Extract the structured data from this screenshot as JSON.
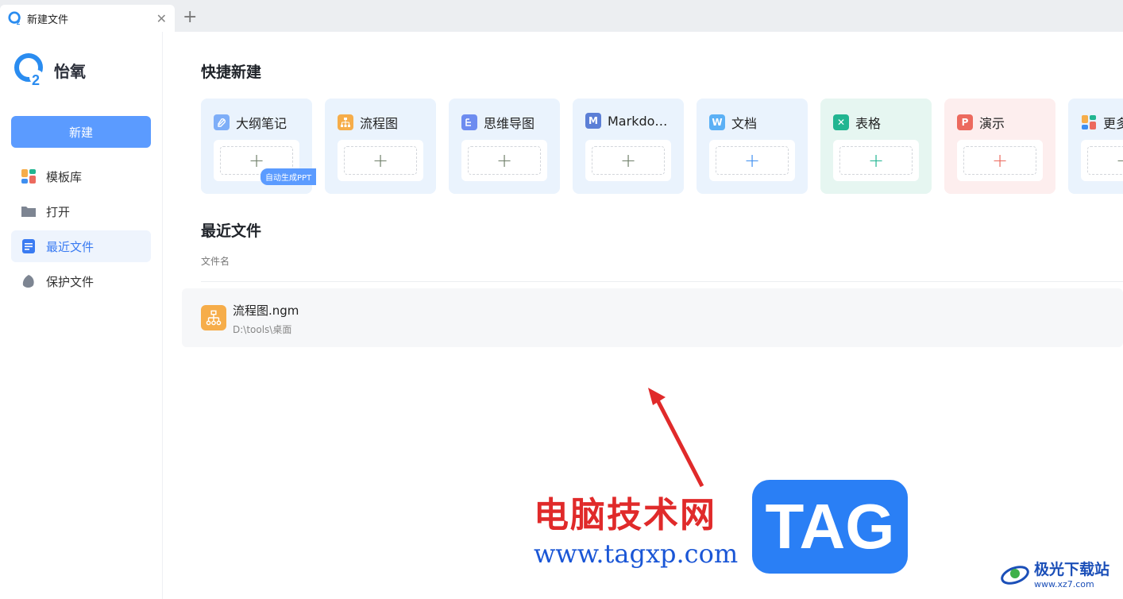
{
  "tab": {
    "title": "新建文件",
    "close": "✕",
    "new_tab": "+"
  },
  "sidebar": {
    "brand": "怡氧",
    "new_button": "新建",
    "items": [
      {
        "label": "模板库",
        "icon": "template-icon"
      },
      {
        "label": "打开",
        "icon": "folder-icon"
      },
      {
        "label": "最近文件",
        "icon": "recent-file-icon",
        "active": true
      },
      {
        "label": "保护文件",
        "icon": "shield-icon"
      }
    ]
  },
  "quick": {
    "title": "快捷新建",
    "badge": "自动生成PPT",
    "cards": [
      {
        "label": "大纲笔记",
        "icon": "outline-note-icon",
        "bg": "#eaf3fd",
        "plus_color": "#6f7f6a"
      },
      {
        "label": "流程图",
        "icon": "flowchart-icon",
        "bg": "#eaf3fd",
        "plus_color": "#6f7f6a"
      },
      {
        "label": "思维导图",
        "icon": "mindmap-icon",
        "bg": "#eaf3fd",
        "plus_color": "#6f7f6a"
      },
      {
        "label": "Markdo…",
        "icon": "markdown-icon",
        "bg": "#eaf3fd",
        "plus_color": "#6f7f6a"
      },
      {
        "label": "文档",
        "icon": "doc-icon",
        "bg": "#eaf3fd",
        "plus_color": "#3f8ff0"
      },
      {
        "label": "表格",
        "icon": "sheet-icon",
        "bg": "#e6f6f1",
        "plus_color": "#22b591"
      },
      {
        "label": "演示",
        "icon": "slides-icon",
        "bg": "#fdeeee",
        "plus_color": "#ec6a5e"
      },
      {
        "label": "更多",
        "icon": "more-icon",
        "bg": "#eaf3fd",
        "plus_color": "#6f7f6a"
      }
    ]
  },
  "recent": {
    "title": "最近文件",
    "column_name": "文件名",
    "files": [
      {
        "name": "流程图.ngm",
        "path": "D:\\tools\\桌面"
      }
    ]
  },
  "watermark": {
    "site_cn": "电脑技术网",
    "site_url": "www.tagxp.com",
    "tag": "TAG",
    "xz_name": "极光下载站",
    "xz_url": "www.xz7.com"
  },
  "colors": {
    "accent": "#5b9bff",
    "active_bg": "#eef4fd",
    "active_text": "#3a7bf2"
  }
}
